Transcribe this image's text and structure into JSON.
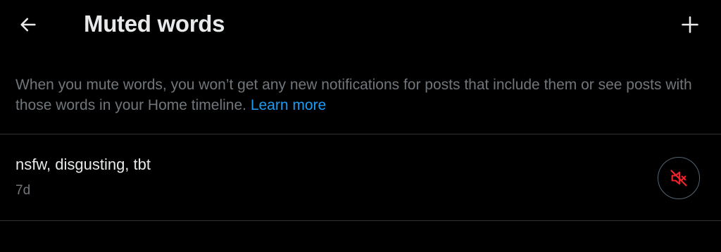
{
  "header": {
    "back_icon": "arrow-left-icon",
    "title": "Muted words",
    "add_icon": "plus-icon"
  },
  "description": {
    "text": "When you mute words, you won’t get any new notifications for posts that include them or see posts with those words in your Home timeline.",
    "link_label": "Learn more"
  },
  "muted_words": [
    {
      "words": "nsfw, disgusting, tbt",
      "age": "7d",
      "action_icon": "speaker-muted-icon"
    }
  ],
  "colors": {
    "background": "#000000",
    "primary_text": "#e7e9ea",
    "secondary_text": "#71767b",
    "link": "#1d9bf0",
    "mute_icon": "#f4212e",
    "divider": "#2f3336"
  }
}
